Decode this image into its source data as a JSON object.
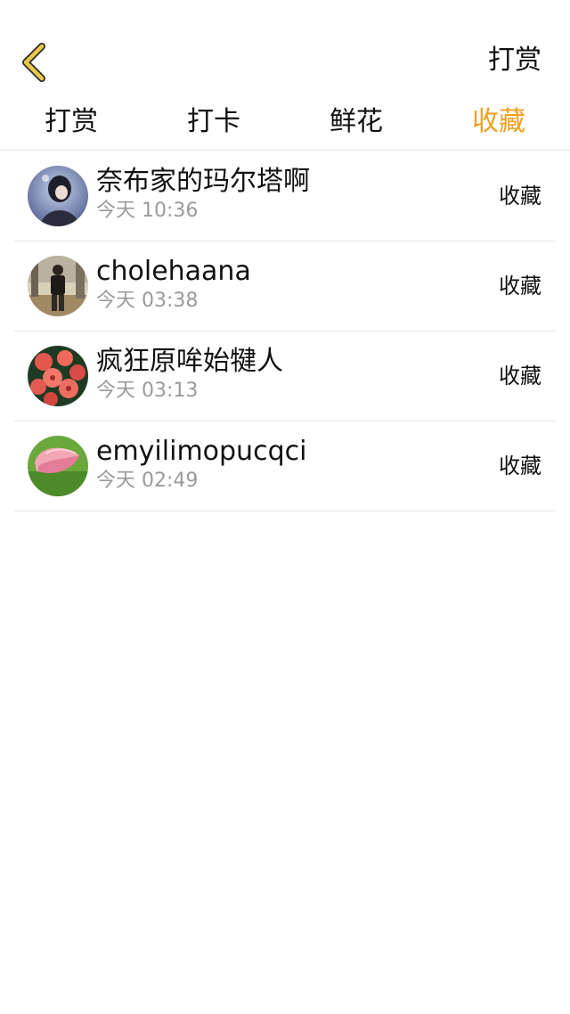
{
  "nav": {
    "back_icon": "chevron-left-icon",
    "back_icon_color": "#d6b236",
    "action_label": "打赏"
  },
  "tabs": [
    {
      "label": "打赏",
      "active": false
    },
    {
      "label": "打卡",
      "active": false
    },
    {
      "label": "鲜花",
      "active": false
    },
    {
      "label": "收藏",
      "active": true
    }
  ],
  "colors": {
    "active_tab": "#f0a020",
    "time_text": "#9a9a9a",
    "divider": "#e6e6e6"
  },
  "items": [
    {
      "name": "奈布家的玛尔塔啊",
      "time": "今天 10:36",
      "action": "收藏",
      "avatar": "avatar-dark-portrait"
    },
    {
      "name": "cholehaana",
      "time": "今天 03:38",
      "action": "收藏",
      "avatar": "avatar-person-standing"
    },
    {
      "name": "疯狂原哞始犍人",
      "time": "今天 03:13",
      "action": "收藏",
      "avatar": "avatar-red-flowers"
    },
    {
      "name": "emyilimopucqci",
      "time": "今天 02:49",
      "action": "收藏",
      "avatar": "avatar-pink-tulip"
    }
  ]
}
